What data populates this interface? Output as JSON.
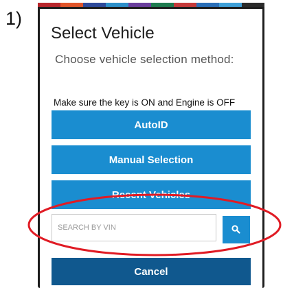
{
  "step_label": "1)",
  "top_strip_colors": [
    "#b8272c",
    "#e0552a",
    "#2e4a9a",
    "#2c8fc9",
    "#6a3e9c",
    "#1f7b4f",
    "#c53a3a",
    "#2a6fb8",
    "#3fa0d8",
    "#2b2b2b"
  ],
  "dialog": {
    "title": "Select Vehicle",
    "subtitle": "Choose vehicle selection method:",
    "instruction": "Make sure the key is ON and Engine is OFF"
  },
  "buttons": {
    "autoid": "AutoID",
    "manual": "Manual Selection",
    "recent": "Recent Vehicles",
    "cancel": "Cancel"
  },
  "search": {
    "placeholder": "SEARCH BY VIN",
    "icon": "search-icon"
  },
  "annotation": {
    "color": "#e01b24",
    "shape": "ellipse"
  },
  "colors": {
    "accent": "#1a8dd0",
    "cancel": "#10588e"
  }
}
